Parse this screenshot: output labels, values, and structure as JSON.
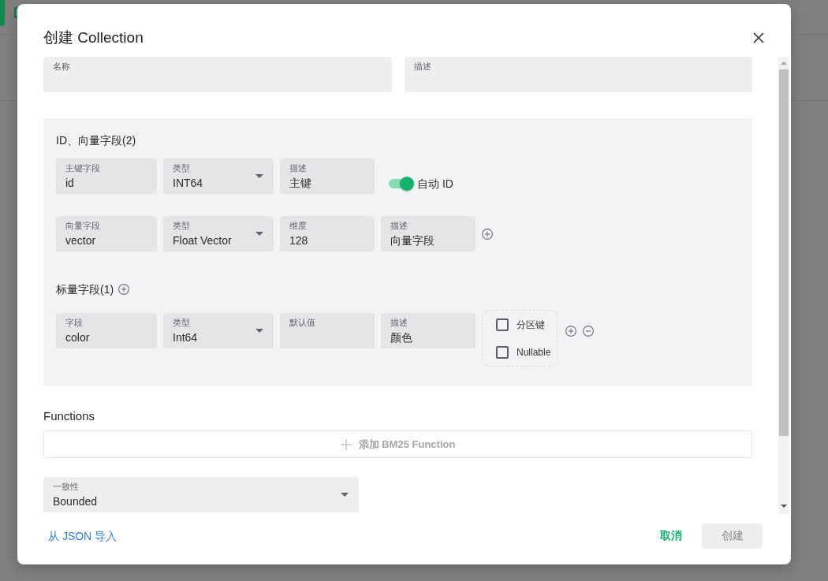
{
  "window": {
    "title": "创建 Collection"
  },
  "general_fields": [
    {
      "kind": "input",
      "label": "名称"
    },
    {
      "kind": "input",
      "label": "描述"
    }
  ],
  "id_vector_section": {
    "title": "ID、向量字段(2)",
    "rows": [
      {
        "fields": [
          {
            "kind": "input",
            "label": "主键字段",
            "value": "id"
          },
          {
            "kind": "select",
            "label": "类型",
            "value": "INT64"
          },
          {
            "kind": "input",
            "label": "描述",
            "value": "主键"
          }
        ],
        "toggle": {
          "label": "自动 ID",
          "on": true
        }
      },
      {
        "fields": [
          {
            "kind": "input",
            "label": "向量字段",
            "value": "vector"
          },
          {
            "kind": "select",
            "label": "类型",
            "value": "Float Vector"
          },
          {
            "kind": "input",
            "label": "维度",
            "value": "128"
          },
          {
            "kind": "input",
            "label": "描述",
            "value": "向量字段"
          }
        ],
        "actions": [
          {
            "kind": "add"
          }
        ]
      }
    ]
  },
  "scalar_section": {
    "title": "标量字段(1)",
    "title_actions": [
      {
        "kind": "add"
      }
    ],
    "rows": [
      {
        "fields": [
          {
            "kind": "input",
            "label": "字段",
            "value": "color"
          },
          {
            "kind": "select",
            "label": "类型",
            "value": "Int64"
          },
          {
            "kind": "input",
            "label": "默认值"
          },
          {
            "kind": "input",
            "label": "描述",
            "value": "颜色"
          }
        ],
        "options": [
          {
            "label": "分区键",
            "checked": false
          },
          {
            "label": "Nullable",
            "checked": false
          }
        ],
        "actions": [
          {
            "kind": "add"
          },
          {
            "kind": "remove"
          }
        ]
      }
    ]
  },
  "functions": {
    "title": "Functions",
    "add_button": {
      "label": "添加 BM25 Function",
      "disabled": true
    }
  },
  "consistency": {
    "kind": "select",
    "label": "一致性",
    "value": "Bounded"
  },
  "footer": {
    "link": "从 JSON 导入",
    "buttons": [
      {
        "kind": "text",
        "label": "取消",
        "disabled": false
      },
      {
        "kind": "primary",
        "label": "创建",
        "disabled": true
      }
    ]
  }
}
